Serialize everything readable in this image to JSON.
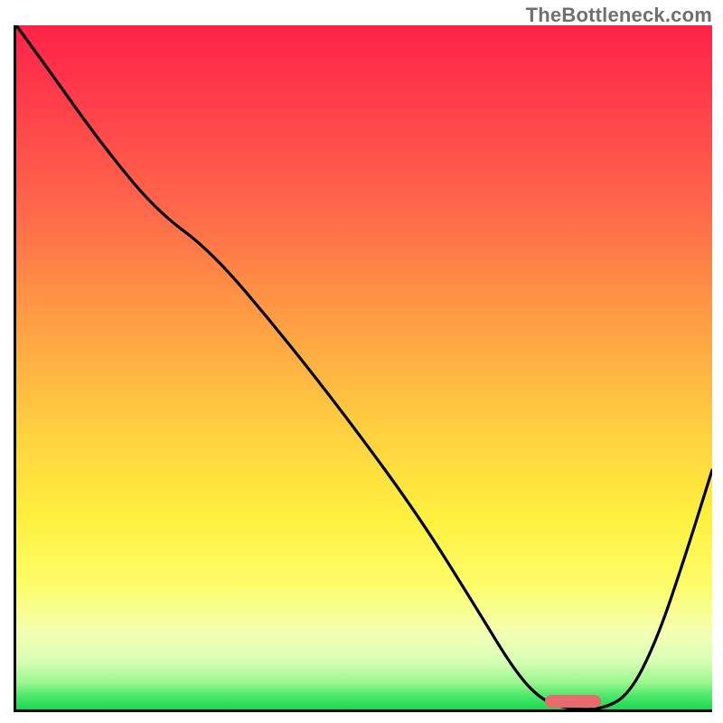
{
  "watermark": "TheBottleneck.com",
  "chart_data": {
    "type": "line",
    "title": "",
    "xlabel": "",
    "ylabel": "",
    "xlim": [
      0,
      100
    ],
    "ylim": [
      0,
      100
    ],
    "grid": false,
    "gradient_colors": {
      "top": "#ff2247",
      "upper_mid": "#ffa443",
      "mid": "#fff03e",
      "lower_mid": "#d6ffb4",
      "bottom": "#18d94b"
    },
    "series": [
      {
        "name": "bottleneck-curve",
        "color": "#000000",
        "x": [
          0,
          5,
          12,
          20,
          28,
          38,
          48,
          58,
          66,
          72,
          76,
          80,
          84,
          88,
          92,
          96,
          100
        ],
        "y": [
          100,
          93,
          83,
          73,
          67,
          55,
          42,
          28,
          15,
          5,
          1,
          0,
          0,
          2,
          10,
          22,
          35
        ]
      }
    ],
    "marker": {
      "name": "optimal-range",
      "color": "#e86a6e",
      "x_start": 76,
      "x_end": 84,
      "y": 0
    }
  }
}
